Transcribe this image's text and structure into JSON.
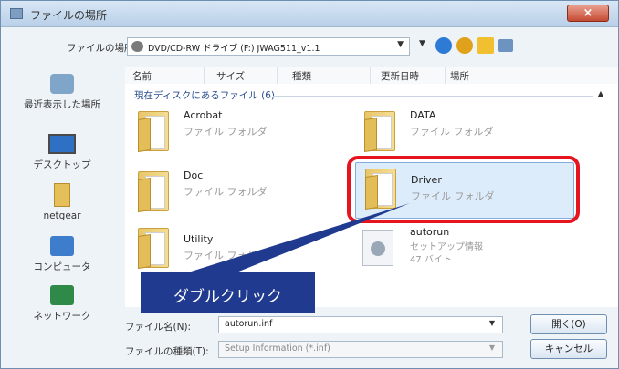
{
  "window": {
    "title": "ファイルの場所"
  },
  "toolbar": {
    "location_label": "ファイルの場所(I):",
    "location_value": "DVD/CD-RW ドライブ (F:) JWAG511_v1.1"
  },
  "columns": [
    "名前",
    "サイズ",
    "種類",
    "更新日時",
    "場所"
  ],
  "places": [
    {
      "label": "最近表示した場所",
      "icon": "recent-places-icon"
    },
    {
      "label": "デスクトップ",
      "icon": "desktop-icon"
    },
    {
      "label": "netgear",
      "icon": "user-folder-icon"
    },
    {
      "label": "コンピュータ",
      "icon": "computer-icon"
    },
    {
      "label": "ネットワーク",
      "icon": "network-icon"
    }
  ],
  "group": {
    "header": "現在ディスクにあるファイル (6)"
  },
  "files": [
    {
      "name": "Acrobat",
      "type": "ファイル フォルダ"
    },
    {
      "name": "DATA",
      "type": "ファイル フォルダ"
    },
    {
      "name": "Doc",
      "type": "ファイル フォルダ"
    },
    {
      "name": "Driver",
      "type": "ファイル フォルダ",
      "selected": true
    },
    {
      "name": "Utility",
      "type": "ファイル フォルダ"
    },
    {
      "name": "autorun",
      "type": "セットアップ情報",
      "size": "47 バイト"
    }
  ],
  "filename": {
    "label": "ファイル名(N):",
    "value": "autorun.inf"
  },
  "filetype": {
    "label": "ファイルの種類(T):",
    "value": "Setup Information (*.inf)"
  },
  "buttons": {
    "open": "開く(O)",
    "cancel": "キャンセル"
  },
  "annotation": {
    "text": "ダブルクリック"
  },
  "colors": {
    "callout": "#1f3a8f",
    "highlight": "#e5141f",
    "selection": "#dcecfb"
  }
}
